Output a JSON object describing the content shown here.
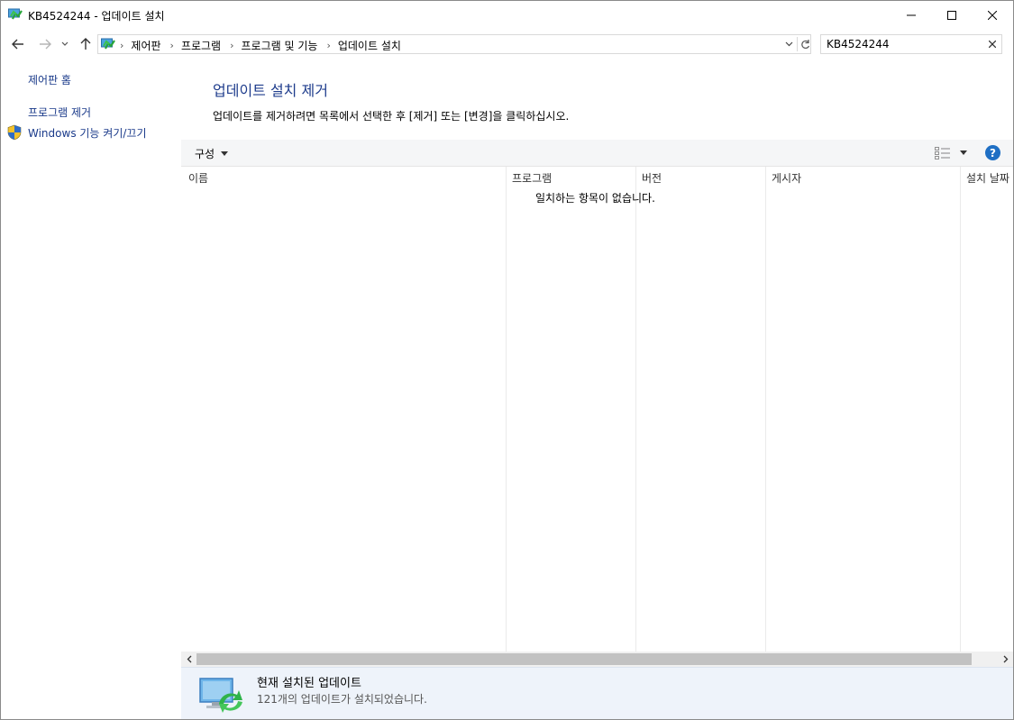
{
  "window": {
    "title": "KB4524244 - 업데이트 설치",
    "icon": "control-panel-update-icon"
  },
  "address": {
    "breadcrumbs": [
      "제어판",
      "프로그램",
      "프로그램 및 기능",
      "업데이트 설치"
    ]
  },
  "search": {
    "value": "KB4524244"
  },
  "sidebar": {
    "home_label": "제어판 홈",
    "remove_program_label": "프로그램 제거",
    "windows_features_label": "Windows 기능 켜기/끄기"
  },
  "main": {
    "title": "업데이트 설치 제거",
    "description": "업데이트를 제거하려면 목록에서 선택한 후 [제거] 또는 [변경]을 클릭하십시오."
  },
  "toolbar": {
    "organize_label": "구성",
    "help_label": "?"
  },
  "list": {
    "columns": [
      "이름",
      "프로그램",
      "버전",
      "게시자",
      "설치 날짜"
    ],
    "empty_message": "일치하는 항목이 없습니다."
  },
  "details": {
    "title": "현재 설치된 업데이트",
    "subtitle": "121개의 업데이트가 설치되었습니다."
  },
  "colors": {
    "link": "#1a3a8a",
    "title_blue": "#1e3c8c",
    "help_blue": "#1f6fc4",
    "details_bg": "#eef3fa"
  }
}
